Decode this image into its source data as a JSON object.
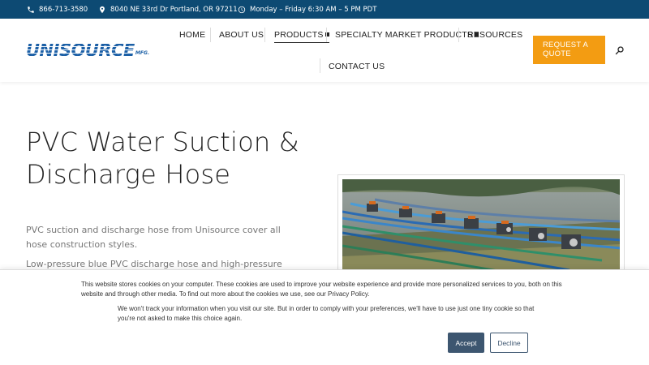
{
  "topbar": {
    "phone": "866-713-3580",
    "address": "8040 NE 33rd Dr Portland, OR 97211",
    "hours": "Monday – Friday 6:30 AM – 5 PM PDT"
  },
  "header": {
    "logo_text": "UNISOURCE",
    "logo_sub": "MFG.",
    "nav": [
      {
        "label": "HOME"
      },
      {
        "label": "ABOUT US"
      },
      {
        "label": "PRODUCTS"
      },
      {
        "label": "SPECIALTY MARKET PRODUCTS"
      },
      {
        "label": "RESOURCES"
      },
      {
        "label": "CONTACT US"
      }
    ],
    "quote_button": "REQUEST A QUOTE"
  },
  "main": {
    "title": "PVC Water Suction & Discharge Hose",
    "paragraphs": [
      "PVC suction and discharge hose from Unisource cover all hose construction styles.",
      "Low-pressure blue PVC discharge hose and high-pressure red PVC"
    ]
  },
  "cookie": {
    "text1": "This website stores cookies on your computer. These cookies are used to improve your website experience and provide more personalized services to you, both on this website and through other media. To find out more about the cookies we use, see our Privacy Policy.",
    "text2": "We won't track your information when you visit our site. But in order to comply with your preferences, we'll have to use just one tiny cookie so that you're not asked to make this choice again.",
    "accept": "Accept",
    "decline": "Decline"
  },
  "colors": {
    "topbar": "#0d4a73",
    "accent": "#f39c12",
    "logo": "#1b5fa6",
    "button_dark": "#3d5670"
  }
}
